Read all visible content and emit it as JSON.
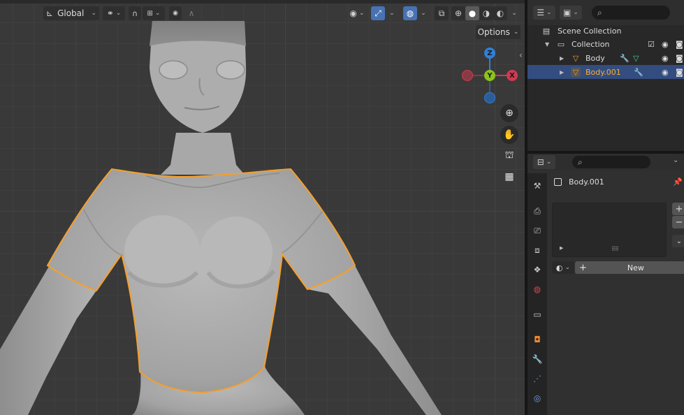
{
  "viewport": {
    "orientation_label": "Global",
    "options_label": "Options",
    "gizmo": {
      "z": "Z",
      "y": "Y",
      "x": "X"
    }
  },
  "outliner": {
    "rows": [
      {
        "label": "Scene Collection"
      },
      {
        "label": "Collection"
      },
      {
        "label": "Body"
      },
      {
        "label": "Body.001"
      }
    ]
  },
  "properties": {
    "object_name": "Body.001",
    "new_button_label": "New"
  },
  "colors": {
    "selection_outline": "#f59f2c",
    "active_blue": "#4772b3",
    "x_axis": "#d13a50",
    "y_axis": "#8bc31c",
    "z_axis": "#2f7fd7",
    "selected_row": "#334d80",
    "selected_text": "#ffaf29"
  }
}
